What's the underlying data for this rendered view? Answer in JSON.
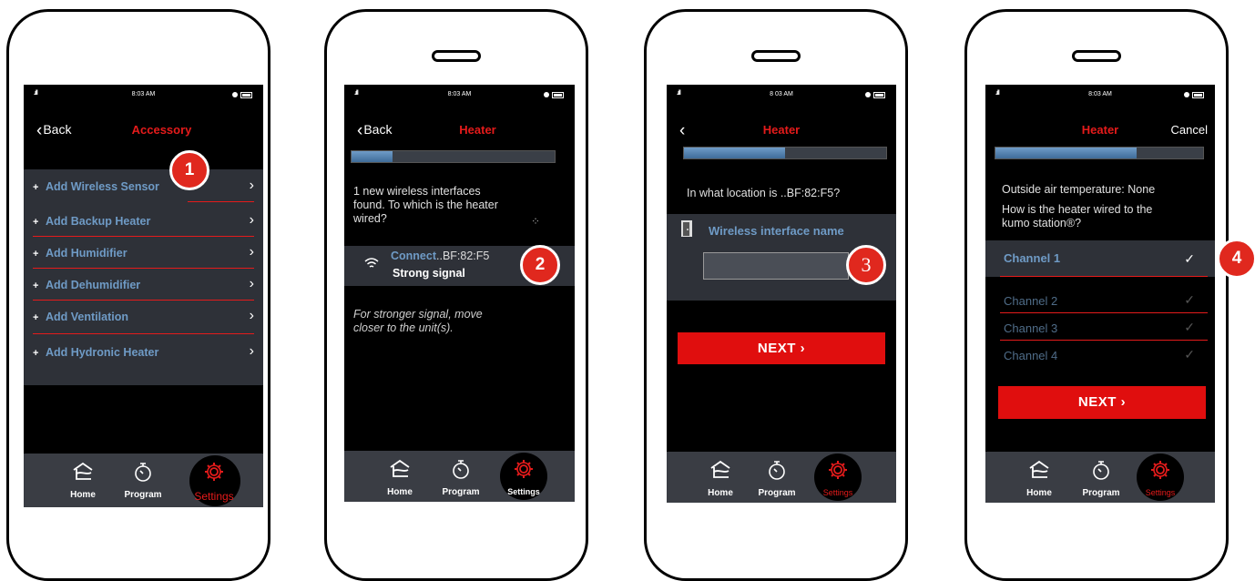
{
  "status_bar": {
    "signal": ".ıll",
    "time1": "8:03 AM",
    "time2": "8:03 AM",
    "time3": "8 03 AM",
    "time4": "8:03 AM"
  },
  "tabs": {
    "home": "Home",
    "program": "Program",
    "settings": "Settings"
  },
  "back_label": "Back",
  "screen1": {
    "title": "Accessory",
    "items": [
      {
        "label": "Add Wireless Sensor"
      },
      {
        "label": "Add Backup Heater"
      },
      {
        "label": "Add Humidifier"
      },
      {
        "label": "Add Dehumidifier"
      },
      {
        "label": "Add Ventilation"
      },
      {
        "label": "Add Hydronic Heater"
      }
    ],
    "plus": "+",
    "badge": "1"
  },
  "screen2": {
    "title": "Heater",
    "progress": 0.2,
    "prompt": "1 new wireless interfaces found. To which is the heater wired?",
    "connect_label": "Connect",
    "connect_id": "..BF:82:F5",
    "signal_label": "Strong signal",
    "hint": "For stronger signal, move closer to the  unit(s).",
    "badge": "2"
  },
  "screen3": {
    "title": "Heater",
    "progress": 0.5,
    "prompt": "In what location is  ..BF:82:F5?",
    "field_label": "Wireless interface name",
    "field_value": "",
    "next_label": "NEXT",
    "badge": "3"
  },
  "screen4": {
    "title": "Heater",
    "cancel_label": "Cancel",
    "progress": 0.68,
    "outside_temp": "Outside air temperature: None",
    "prompt": "How is the heater wired to the kumo station®?",
    "channels": [
      {
        "label": "Channel 1",
        "selected": true
      },
      {
        "label": "Channel 2",
        "selected": false
      },
      {
        "label": "Channel 3",
        "selected": false
      },
      {
        "label": "Channel 4",
        "selected": false
      }
    ],
    "next_label": "NEXT",
    "badge": "4"
  },
  "colors": {
    "accent": "#e51b1b",
    "link_blue": "#6f9bc6",
    "next_bg": "#e00e0e"
  },
  "icons": {
    "chevron_right": "›",
    "chevron_left": "‹",
    "check": "✓"
  }
}
